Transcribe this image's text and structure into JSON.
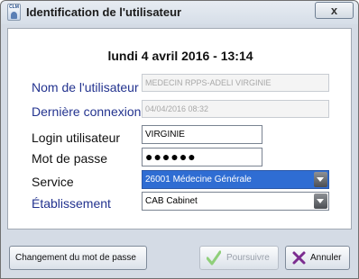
{
  "window": {
    "title": "Identification de l'utilisateur",
    "app_icon_text": "CLM",
    "close_label": "x"
  },
  "header": {
    "datetime": "lundi 4 avril 2016  -  13:14"
  },
  "form": {
    "user_name": {
      "label": "Nom de l'utilisateur",
      "value": "MEDECIN RPPS-ADELI VIRGINIE"
    },
    "last_login": {
      "label": "Dernière connexion",
      "value": "04/04/2016 08:32"
    },
    "login": {
      "label": "Login utilisateur",
      "value": "VIRGINIE"
    },
    "password": {
      "label": "Mot de passe",
      "value": "●●●●●●"
    },
    "service": {
      "label": "Service",
      "value": "26001 Médecine Générale"
    },
    "establishment": {
      "label": "Établissement",
      "value": "CAB Cabinet"
    }
  },
  "footer": {
    "change_password": "Changement du mot de passe",
    "continue": "Poursuivre",
    "cancel": "Annuler"
  },
  "colors": {
    "label_blue": "#23338f",
    "selection_blue": "#2f6dd3",
    "check_green": "#8fcf7a",
    "cancel_purple": "#7b2c8f"
  }
}
